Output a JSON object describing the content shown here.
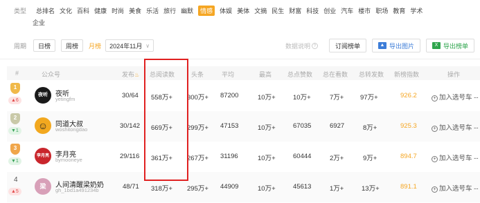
{
  "filters": {
    "type_label": "类型",
    "categories_row1": [
      "总排名",
      "文化",
      "百科",
      "健康",
      "时尚",
      "美食",
      "乐活",
      "旅行",
      "幽默",
      "情感",
      "体娱",
      "美体",
      "文摘",
      "民生",
      "财富",
      "科技",
      "创业",
      "汽车",
      "楼市",
      "职场",
      "教育",
      "学术"
    ],
    "categories_row2": [
      "企业"
    ],
    "active_category": "情感"
  },
  "period": {
    "label": "周期",
    "daily": "日榜",
    "weekly": "周榜",
    "monthly": "月榜",
    "selected_month": "2024年11月",
    "note": "数据说明",
    "subscribe": "订阅榜单",
    "export_image": "导出图片",
    "export_list": "导出榜单"
  },
  "table": {
    "headers": {
      "rank": "#",
      "account": "公众号",
      "published": "发布",
      "total_reads": "总阅读数",
      "headline": "头条",
      "average": "平均",
      "max": "最高",
      "total_likes": "总点赞数",
      "total_watching": "总在看数",
      "total_shares": "总转发数",
      "index": "新榜指数",
      "action": "操作"
    },
    "rows": [
      {
        "rank": "1",
        "change": "▲6",
        "dir": "up",
        "name": "夜听",
        "id": "yetingfm",
        "published": "30/64",
        "reads": "558万+",
        "headline": "300万+",
        "avg": "87200",
        "max": "10万+",
        "likes": "10万+",
        "watching": "7万+",
        "shares": "97万+",
        "index": "926.2",
        "action": "加入选号车",
        "avatar_text": "夜听",
        "avatar_color": "#1a1a1a"
      },
      {
        "rank": "2",
        "change": "▼1",
        "dir": "down",
        "name": "同道大叔",
        "id": "woshitongdao",
        "published": "30/142",
        "reads": "669万+",
        "headline": "299万+",
        "avg": "47153",
        "max": "10万+",
        "likes": "67035",
        "watching": "6927",
        "shares": "8万+",
        "index": "925.3",
        "action": "加入选号车",
        "avatar_text": "☺",
        "avatar_color": "#f2a81f"
      },
      {
        "rank": "3",
        "change": "▼1",
        "dir": "down",
        "name": "李月亮",
        "id": "bymooneye",
        "published": "29/116",
        "reads": "361万+",
        "headline": "267万+",
        "avg": "31196",
        "max": "10万+",
        "likes": "60444",
        "watching": "2万+",
        "shares": "9万+",
        "index": "894.7",
        "action": "加入选号车",
        "avatar_text": "李月亮",
        "avatar_color": "#c9262c"
      },
      {
        "rank": "4",
        "change": "▲5",
        "dir": "up",
        "name": "人间清醒梁奶奶",
        "id": "gh_1bd1a491234b",
        "published": "48/71",
        "reads": "318万+",
        "headline": "295万+",
        "avg": "44909",
        "max": "10万+",
        "likes": "45613",
        "watching": "1万+",
        "shares": "13万+",
        "index": "891.1",
        "action": "加入选号车",
        "avatar_text": "梁",
        "avatar_color": "#d8a0b8"
      }
    ]
  }
}
